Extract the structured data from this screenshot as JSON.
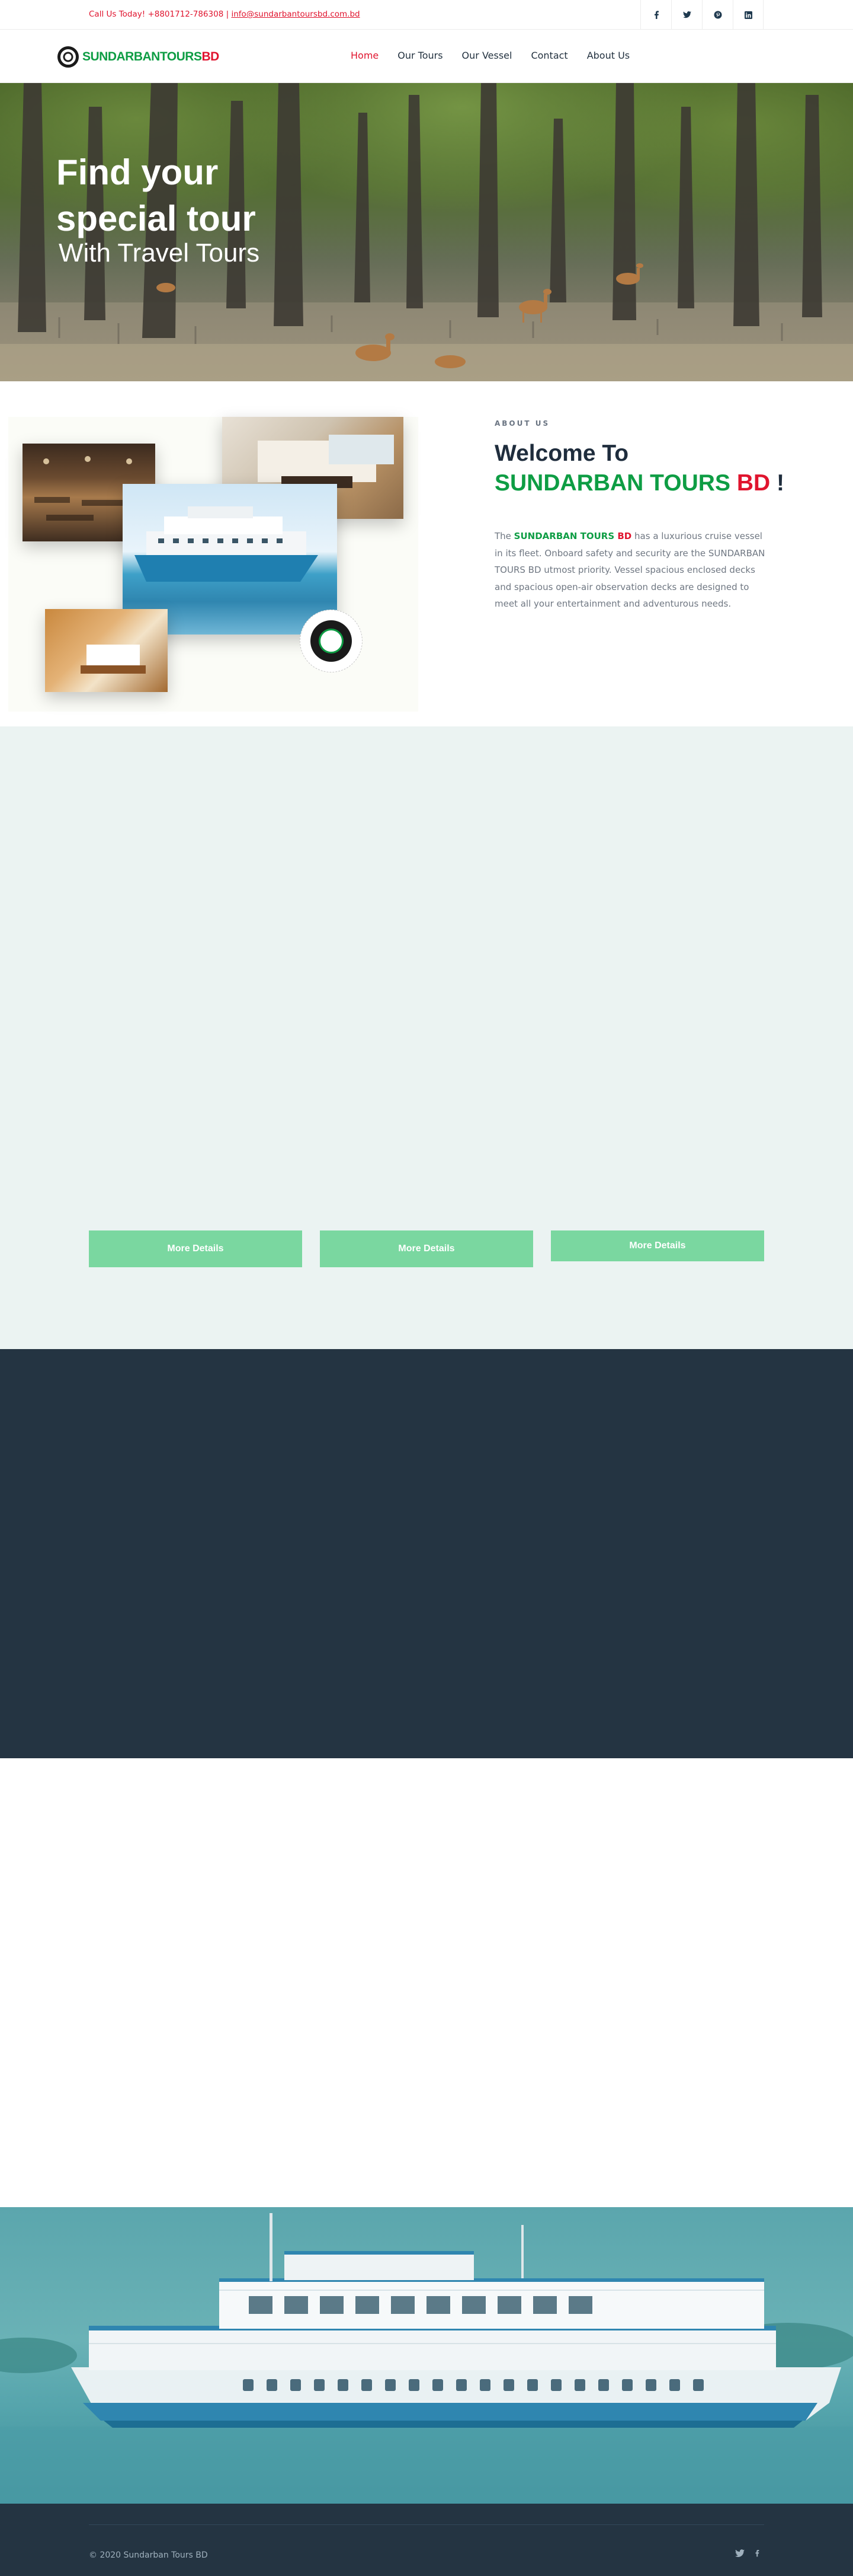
{
  "topbar": {
    "call_text": "Call Us Today! +8801712-786308",
    "separator": " | ",
    "email": "info@sundarbantoursbd.com.bd",
    "social": [
      {
        "icon": "facebook-icon",
        "glyph": "f"
      },
      {
        "icon": "twitter-icon",
        "glyph": "🐦"
      },
      {
        "icon": "pinterest-icon",
        "glyph": "℗"
      },
      {
        "icon": "linkedin-icon",
        "glyph": "in"
      }
    ]
  },
  "brand": {
    "logo_green": "SUNDARBANTOURS",
    "logo_red": "BD",
    "green": "#0e9d44",
    "red": "#e0142e"
  },
  "nav": {
    "items": [
      "Home",
      "Our Tours",
      "Our Vessel",
      "Contact",
      "About Us"
    ],
    "active": "Home"
  },
  "hero": {
    "line1": "Find your",
    "line2": "special tour",
    "line3": "With Travel Tours"
  },
  "about": {
    "eyebrow": "ABOUT US",
    "title_line1": "Welcome To",
    "title_green": "SUNDARBAN TOURS",
    "title_red": "BD",
    "title_end": "!",
    "para_prefix": "The ",
    "para_brand_green": "SUNDARBAN TOURS",
    "para_brand_red": " BD",
    "para_rest": " has a luxurious cruise vessel in its fleet. Onboard safety and security are the SUNDARBAN TOURS BD utmost priority. Vessel spacious enclosed decks and spacious open-air observation decks are designed to meet all your entertainment and adventurous needs."
  },
  "tours": {
    "buttons": [
      "More Details",
      "More Details",
      "More Details"
    ],
    "button_color": "#7ad7a0"
  },
  "footer": {
    "copyright": "© 2020 Sundarban Tours BD",
    "social": [
      {
        "icon": "twitter-icon",
        "glyph": "🐦"
      },
      {
        "icon": "facebook-icon",
        "glyph": "f"
      }
    ]
  }
}
